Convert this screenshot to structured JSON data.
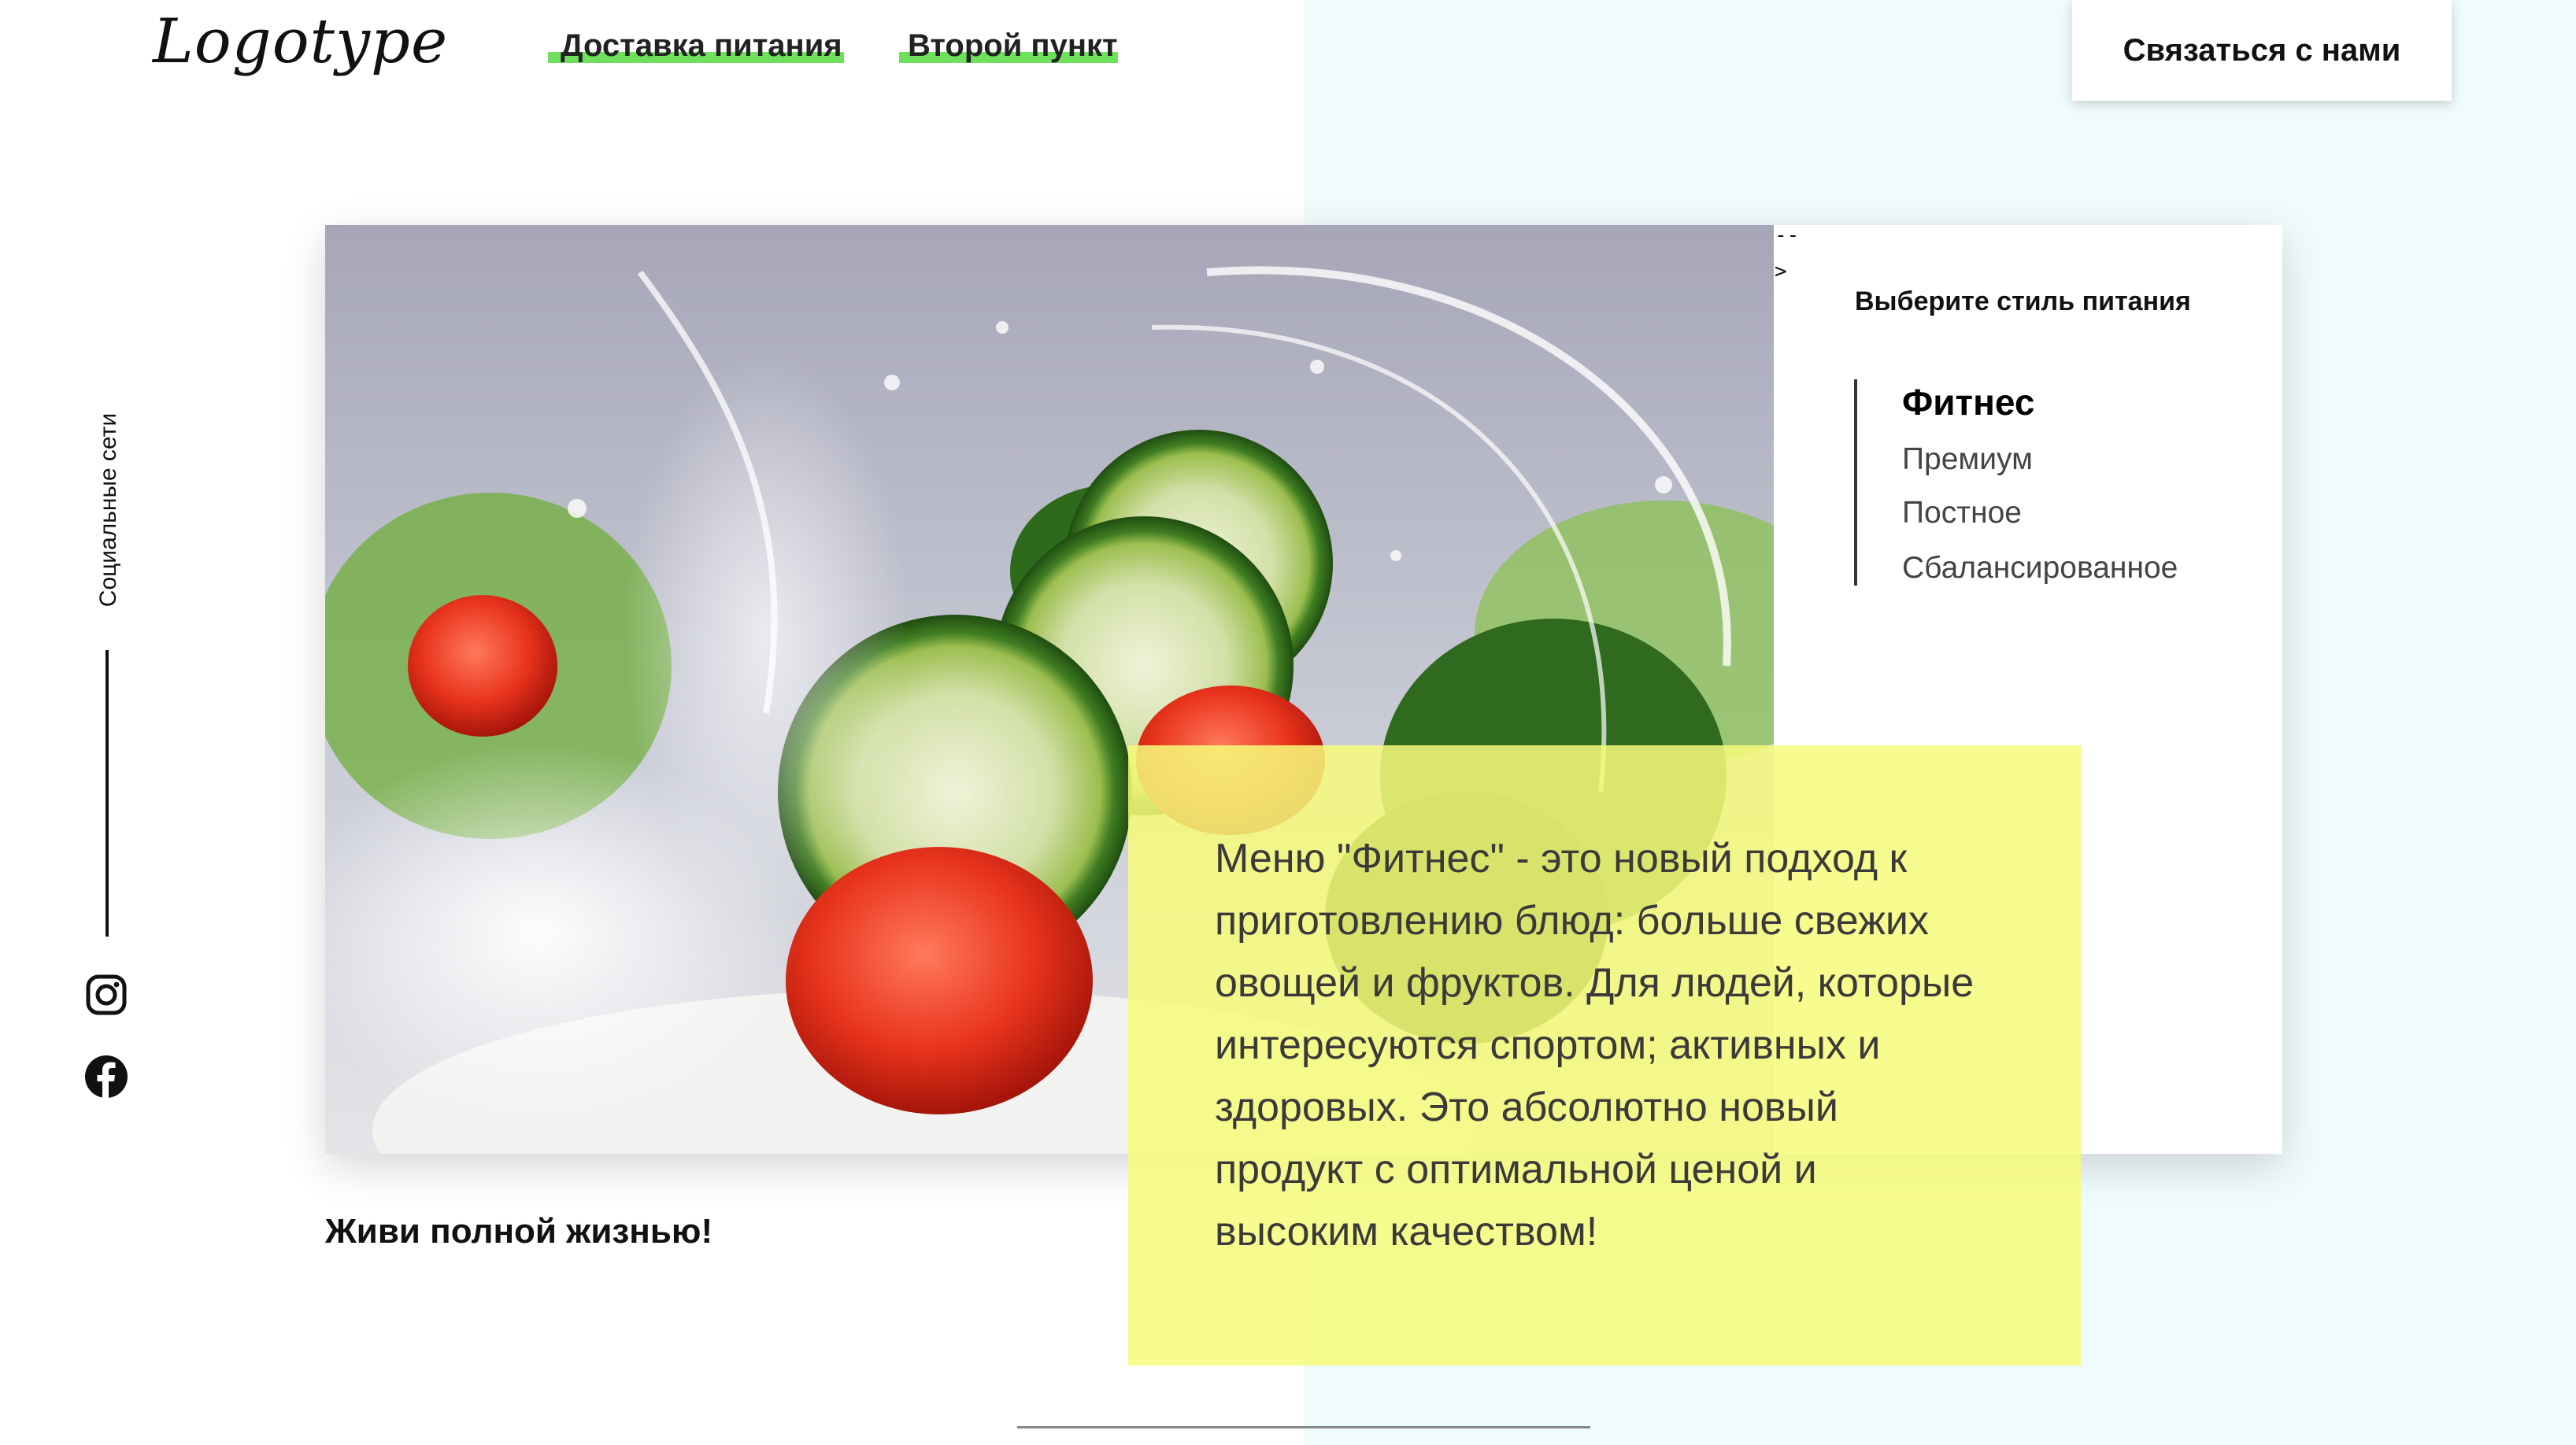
{
  "header": {
    "logo": "Logotype",
    "nav": [
      {
        "label": "Доставка питания"
      },
      {
        "label": "Второй пункт"
      }
    ],
    "contact_label": "Связаться с нами",
    "accent_color": "#6ee05c"
  },
  "social": {
    "label": "Социальные сети",
    "icons": [
      "instagram-icon",
      "facebook-icon"
    ]
  },
  "hero": {
    "image": "salad with cucumbers, tomatoes, parsley and water splash",
    "glyph_dash": "--",
    "glyph_arrow": ">"
  },
  "styles_panel": {
    "title": "Выберите стиль питания",
    "items": [
      {
        "label": "Фитнес",
        "active": true
      },
      {
        "label": "Премиум",
        "active": false
      },
      {
        "label": "Постное",
        "active": false
      },
      {
        "label": "Сбалансированное",
        "active": false
      }
    ]
  },
  "info": {
    "lines": [
      "Меню \"Фитнес\" - это новый подход к",
      "приготовлению блюд: больше свежих",
      "овощей и фруктов. Для людей, которые",
      "интересуются спортом; активных и",
      "здоровых. Это абсолютно новый",
      "продукт с оптимальной ценой и",
      "высоким качеством!"
    ],
    "box_color": "#f7fa7a"
  },
  "tagline": "Живи полной жизнью!",
  "colors": {
    "right_background": "#f0fbfd",
    "accent": "#6ee05c",
    "highlight": "#f7fa7a"
  }
}
